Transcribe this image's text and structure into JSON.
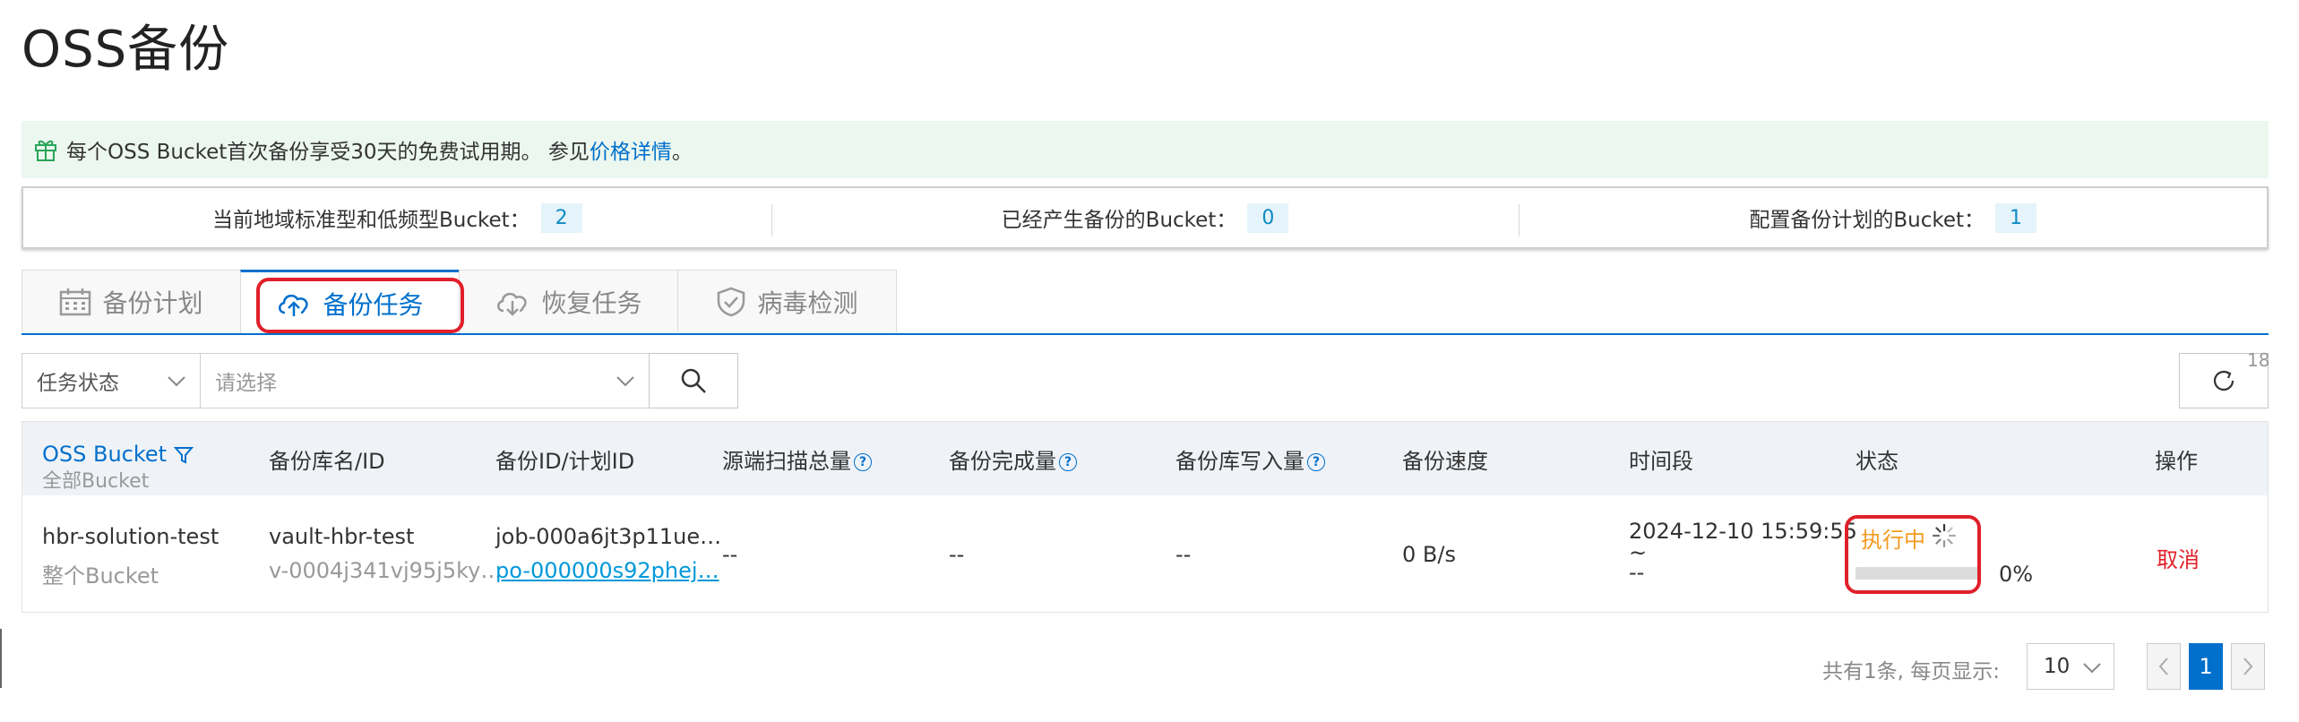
{
  "page": {
    "title": "OSS备份"
  },
  "notice": {
    "text": "每个OSS Bucket首次备份享受30天的免费试用期。 参见",
    "link": "价格详情",
    "end": "。"
  },
  "stats": [
    {
      "label": "当前地域标准型和低频型Bucket：",
      "value": "2"
    },
    {
      "label": "已经产生备份的Bucket：",
      "value": "0"
    },
    {
      "label": "配置备份计划的Bucket：",
      "value": "1"
    }
  ],
  "tabs": [
    {
      "label": "备份计划",
      "icon": "calendar-icon",
      "active": false
    },
    {
      "label": "备份任务",
      "icon": "cloud-upload-icon",
      "active": true
    },
    {
      "label": "恢复任务",
      "icon": "cloud-download-icon",
      "active": false
    },
    {
      "label": "病毒检测",
      "icon": "shield-icon",
      "active": false
    }
  ],
  "filters": {
    "status_label": "任务状态",
    "select_placeholder": "请选择",
    "refresh_count": "18"
  },
  "table": {
    "columns": {
      "bucket": "OSS Bucket",
      "bucket_sub": "全部Bucket",
      "vault": "备份库名/ID",
      "job": "备份ID/计划ID",
      "scan": "源端扫描总量",
      "done": "备份完成量",
      "write": "备份库写入量",
      "speed": "备份速度",
      "period": "时间段",
      "status": "状态",
      "ops": "操作"
    },
    "rows": [
      {
        "bucket": "hbr-solution-test",
        "bucket_sub": "整个Bucket",
        "vault": "vault-hbr-test",
        "vault_id": "v-0004j341vj95j5ky…",
        "job_id": "job-000a6jt3p11ue…",
        "plan_id": "po-000000s92phej…",
        "scan": "--",
        "done": "--",
        "write": "--",
        "speed": "0 B/s",
        "period_start": "2024-12-10 15:59:55",
        "period_sep": "~",
        "period_end": "--",
        "status": "执行中",
        "progress": "0%",
        "progress_value": 0,
        "action": "取消"
      }
    ]
  },
  "pagination": {
    "info": "共有1条, 每页显示:",
    "page_size": "10",
    "current": "1"
  },
  "colors": {
    "accent": "#0070cc",
    "warning": "#f49a1e",
    "danger": "#e0202a",
    "notice_bg": "#ebf7ef"
  }
}
